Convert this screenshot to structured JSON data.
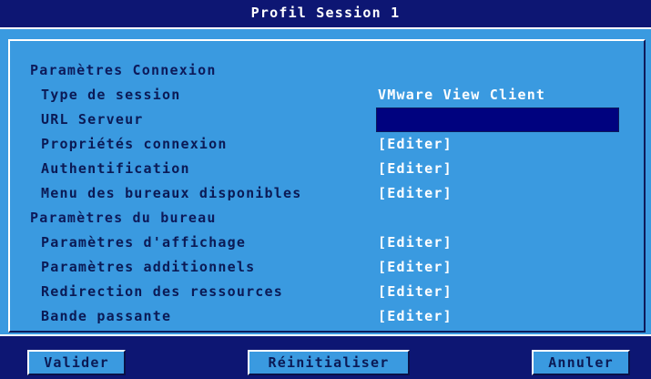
{
  "window": {
    "title": "Profil Session 1"
  },
  "sections": {
    "connexion": "Paramètres Connexion",
    "bureau": "Paramètres du bureau"
  },
  "rows": [
    {
      "label": "Type de session",
      "value": "VMware View Client"
    },
    {
      "label": "URL Serveur",
      "value": ""
    },
    {
      "label": "Propriétés connexion",
      "value": "[Editer]"
    },
    {
      "label": "Authentification",
      "value": "[Editer]"
    },
    {
      "label": "Menu des bureaux disponibles",
      "value": "[Editer]"
    },
    {
      "label": "Paramètres d'affichage",
      "value": "[Editer]"
    },
    {
      "label": "Paramètres additionnels",
      "value": "[Editer]"
    },
    {
      "label": "Redirection des ressources",
      "value": "[Editer]"
    },
    {
      "label": "Bande passante",
      "value": "[Editer]"
    }
  ],
  "buttons": {
    "validate": "Valider",
    "reset": "Réinitialiser",
    "cancel": "Annuler"
  },
  "colors": {
    "panel": "#3a9ae0",
    "navy": "#0d1673",
    "field": "#00027f",
    "text": "#0b1a55",
    "value_text": "#ffffff"
  }
}
